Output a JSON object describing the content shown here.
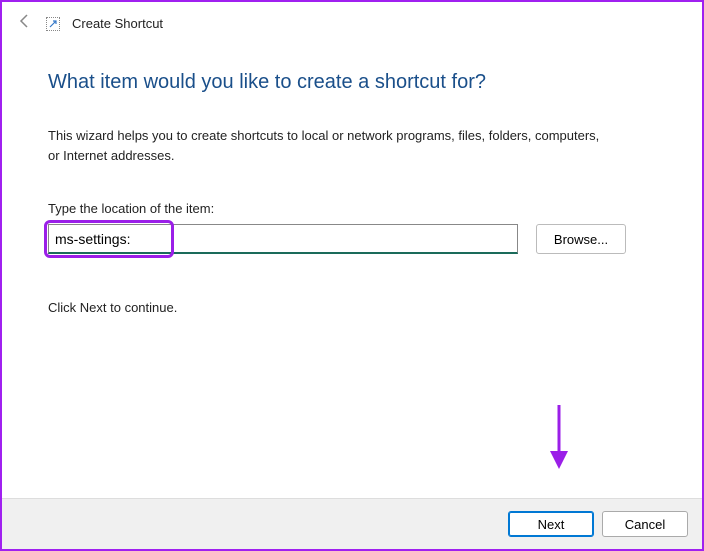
{
  "titlebar": {
    "title": "Create Shortcut"
  },
  "main": {
    "heading": "What item would you like to create a shortcut for?",
    "description": "This wizard helps you to create shortcuts to local or network programs, files, folders, computers, or Internet addresses.",
    "location_label": "Type the location of the item:",
    "location_value": "ms-settings:",
    "browse_label": "Browse...",
    "continue_hint": "Click Next to continue."
  },
  "footer": {
    "next_label": "Next",
    "cancel_label": "Cancel"
  },
  "annotations": {
    "arrow_color": "#9b1fe8",
    "highlight_color": "#9b1fe8"
  }
}
